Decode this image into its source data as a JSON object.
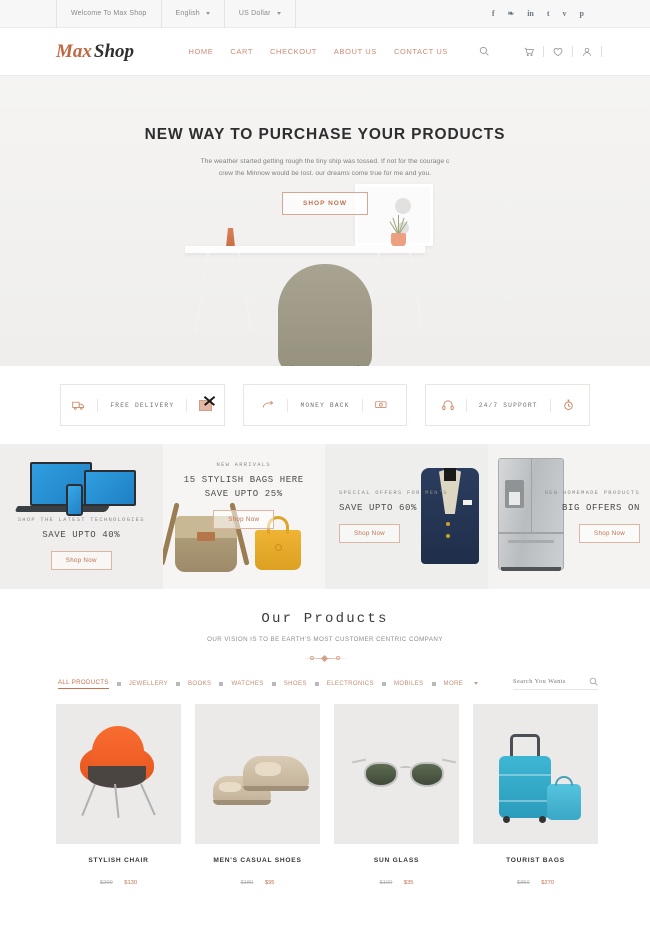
{
  "topbar": {
    "welcome": "Welcome To Max Shop",
    "language": "English",
    "currency": "US Dollar",
    "social": [
      {
        "name": "facebook-icon",
        "glyph": "f"
      },
      {
        "name": "twitter-icon",
        "glyph": "❧"
      },
      {
        "name": "linkedin-icon",
        "glyph": "in"
      },
      {
        "name": "tumblr-icon",
        "glyph": "t"
      },
      {
        "name": "vimeo-icon",
        "glyph": "v"
      },
      {
        "name": "pinterest-icon",
        "glyph": "p"
      }
    ]
  },
  "header": {
    "logo_first": "Max",
    "logo_second": "Shop",
    "nav": [
      "HOME",
      "CART",
      "CHECKOUT",
      "ABOUT US",
      "CONTACT US"
    ]
  },
  "hero": {
    "title": "NEW WAY TO PURCHASE YOUR PRODUCTS",
    "subtitle_line1": "The weather started getting rough the tiny ship was tossed. If not for the courage c",
    "subtitle_line2": "crew the Minnow would be lost. our dreams come true for me and you.",
    "button": "SHOP NOW"
  },
  "features": [
    {
      "label": "FREE DELIVERY",
      "left_icon": "truck-icon",
      "right_icon": "broken-image-icon"
    },
    {
      "label": "MONEY BACK",
      "left_icon": "return-arrow-icon",
      "right_icon": "cash-icon"
    },
    {
      "label": "24/7 SUPPORT",
      "left_icon": "headset-icon",
      "right_icon": "stopwatch-icon"
    }
  ],
  "promos": [
    {
      "kicker": "SHOP THE LATEST TECHNOLOGIES",
      "headline": "SAVE UPTO 40%",
      "button": "Shop Now",
      "art": "laptop"
    },
    {
      "kicker": "NEW ARRIVALS",
      "headline": "15 STYLISH BAGS HERE\nSAVE UPTO 25%",
      "button": "Shop Now",
      "art": "bags"
    },
    {
      "kicker": "SPECIAL OFFERS FOR MEN'S",
      "headline": "SAVE UPTO 60%",
      "button": "Shop Now",
      "art": "suit"
    },
    {
      "kicker": "NEW HOMEMADE PRODUCTS",
      "headline": "BIG OFFERS ON",
      "button": "Shop Now",
      "art": "fridge"
    }
  ],
  "products_section": {
    "title": "Our Products",
    "subtitle": "OUR VISION IS TO BE EARTH'S MOST CUSTOMER CENTRIC COMPANY",
    "filters": [
      "ALL PRODUCTS",
      "JEWELLERY",
      "BOOKS",
      "WATCHES",
      "SHOES",
      "ELECTRONICS",
      "MOBILES",
      "MORE"
    ],
    "active_filter": "ALL PRODUCTS",
    "search_placeholder": "Search You Wants"
  },
  "products": [
    {
      "name": "STYLISH CHAIR",
      "old_price": "$200",
      "new_price": "$130",
      "art": "chair"
    },
    {
      "name": "MEN'S CASUAL SHOES",
      "old_price": "$180",
      "new_price": "$95",
      "art": "shoes"
    },
    {
      "name": "SUN GLASS",
      "old_price": "$100",
      "new_price": "$35",
      "art": "glasses"
    },
    {
      "name": "TOURIST BAGS",
      "old_price": "$350",
      "new_price": "$270",
      "art": "luggage"
    }
  ],
  "colors": {
    "accent": "#c4714e",
    "nav_link": "#d08a74",
    "text_dark": "#2e2e2e",
    "muted": "#8a8a8a"
  }
}
